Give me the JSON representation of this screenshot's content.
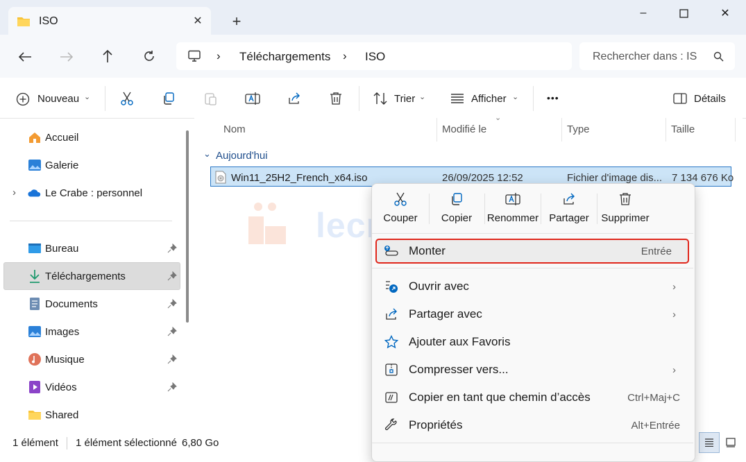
{
  "window": {
    "tab_title": "ISO",
    "new_tab": "+",
    "controls": {
      "minimize": "–",
      "maximize": "☐",
      "close": "✕"
    }
  },
  "address": {
    "crumbs": [
      "Téléchargements",
      "ISO"
    ],
    "search_placeholder": "Rechercher dans : IS"
  },
  "toolbar": {
    "new_label": "Nouveau",
    "sort_label": "Trier",
    "view_label": "Afficher",
    "more_label": "•••",
    "details_label": "Détails"
  },
  "sidebar": {
    "top": [
      {
        "label": "Accueil",
        "icon": "home-icon"
      },
      {
        "label": "Galerie",
        "icon": "gallery-icon"
      },
      {
        "label": "Le Crabe : personnel",
        "icon": "onedrive-icon"
      }
    ],
    "pinned": [
      {
        "label": "Bureau",
        "icon": "desktop-icon"
      },
      {
        "label": "Téléchargements",
        "icon": "download-icon"
      },
      {
        "label": "Documents",
        "icon": "documents-icon"
      },
      {
        "label": "Images",
        "icon": "pictures-icon"
      },
      {
        "label": "Musique",
        "icon": "music-icon"
      },
      {
        "label": "Vidéos",
        "icon": "videos-icon"
      },
      {
        "label": "Shared",
        "icon": "folder-icon"
      }
    ]
  },
  "filelist": {
    "columns": [
      "Nom",
      "Modifié le",
      "Type",
      "Taille"
    ],
    "group_label": "Aujourd'hui",
    "rows": [
      {
        "name": "Win11_25H2_French_x64.iso",
        "modified": "26/09/2025 12:52",
        "type": "Fichier d'image dis...",
        "size": "7 134 676 Ko"
      }
    ]
  },
  "watermark": "lecrabeinfo",
  "status": {
    "count": "1 élément",
    "selected": "1 élément sélectionné",
    "size": "6,80 Go"
  },
  "context_menu": {
    "quick_actions": [
      "Couper",
      "Copier",
      "Renommer",
      "Partager",
      "Supprimer"
    ],
    "items": [
      {
        "label": "Monter",
        "shortcut": "Entrée",
        "icon": "mount-icon"
      },
      {
        "label": "Ouvrir avec",
        "shortcut": "",
        "icon": "open-with-icon"
      },
      {
        "label": "Partager avec",
        "shortcut": "",
        "icon": "share-icon"
      },
      {
        "label": "Ajouter aux Favoris",
        "shortcut": "",
        "icon": "star-icon"
      },
      {
        "label": "Compresser vers...",
        "shortcut": "",
        "icon": "zip-icon"
      },
      {
        "label": "Copier en tant que chemin d’accès",
        "shortcut": "Ctrl+Maj+C",
        "icon": "path-icon"
      },
      {
        "label": "Propriétés",
        "shortcut": "Alt+Entrée",
        "icon": "properties-icon"
      }
    ]
  },
  "colors": {
    "accent": "#0067c0",
    "highlight": "#e0261b",
    "selection": "#cce4f7"
  }
}
